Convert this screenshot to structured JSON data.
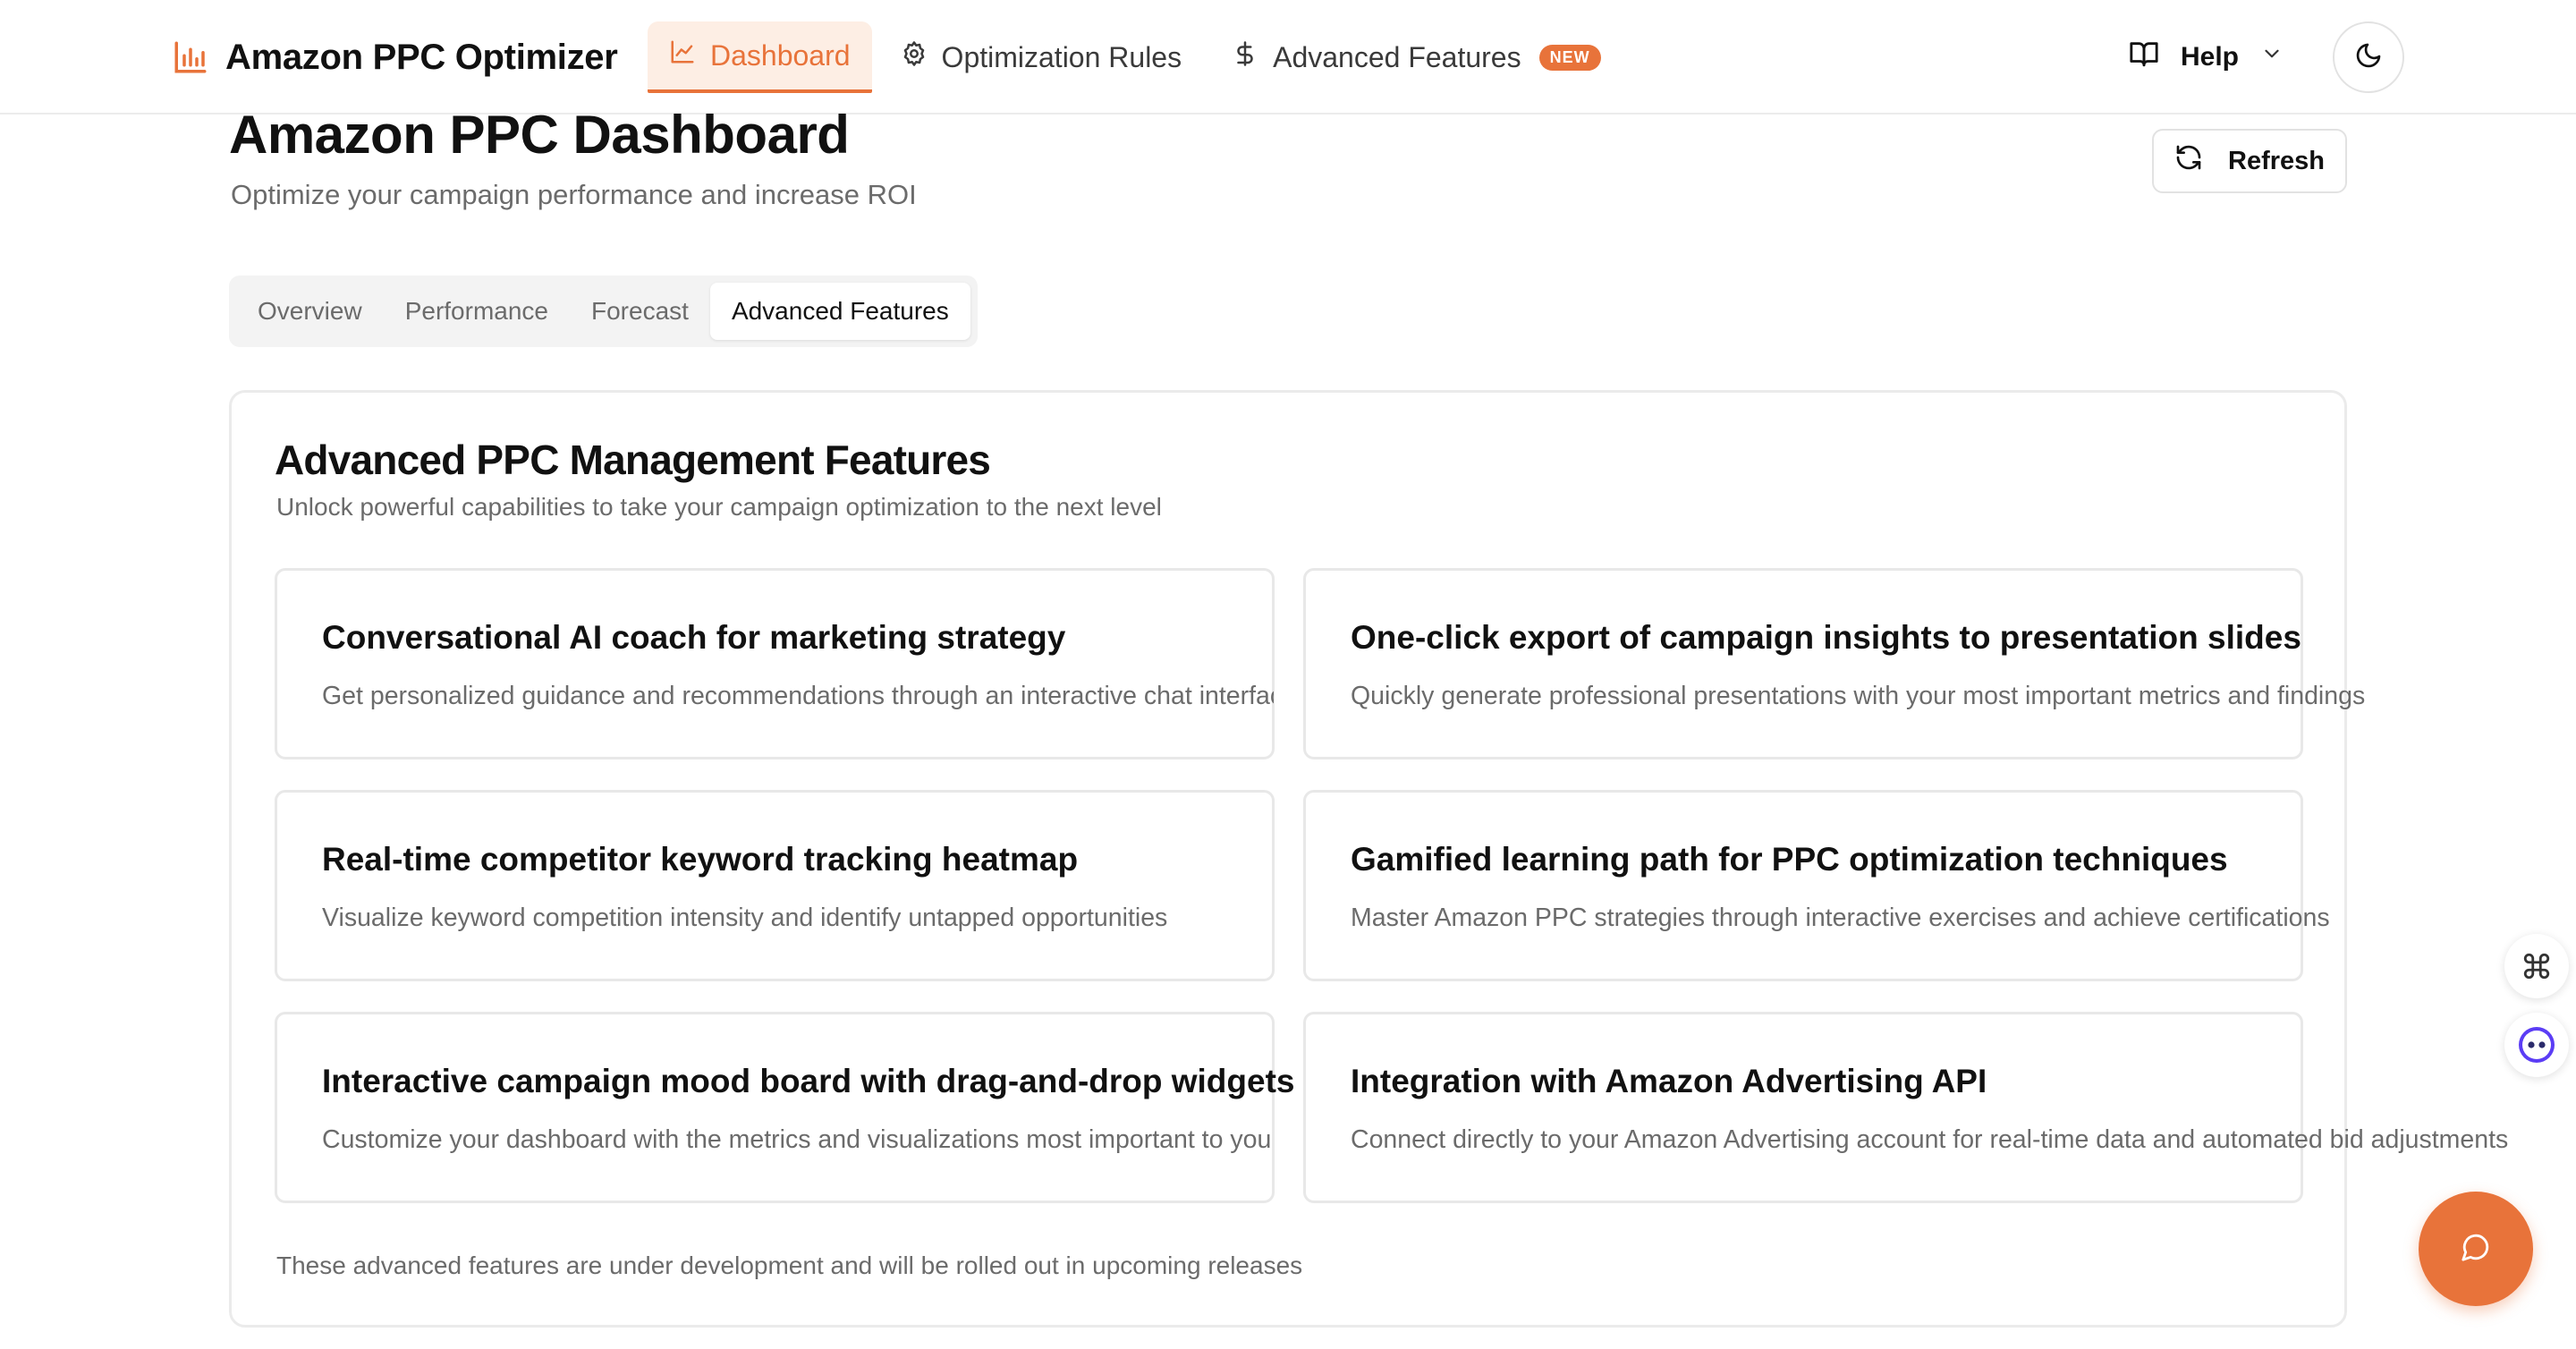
{
  "app": {
    "title": "Amazon PPC Optimizer"
  },
  "nav": {
    "items": [
      {
        "label": "Dashboard",
        "icon": "line-chart-icon"
      },
      {
        "label": "Optimization Rules",
        "icon": "gear-icon"
      },
      {
        "label": "Advanced Features",
        "icon": "dollar-icon",
        "badge": "NEW"
      }
    ],
    "active": "Dashboard"
  },
  "help": {
    "label": "Help"
  },
  "page": {
    "title": "Amazon PPC Dashboard",
    "subtitle": "Optimize your campaign performance and increase ROI",
    "refresh_label": "Refresh"
  },
  "tabs": {
    "items": [
      "Overview",
      "Performance",
      "Forecast",
      "Advanced Features"
    ],
    "active": "Advanced Features"
  },
  "advanced": {
    "title": "Advanced PPC Management Features",
    "subtitle": "Unlock powerful capabilities to take your campaign optimization to the next level",
    "features": [
      {
        "title": "Conversational AI coach for marketing strategy",
        "description": "Get personalized guidance and recommendations through an interactive chat interface"
      },
      {
        "title": "One-click export of campaign insights to presentation slides",
        "description": "Quickly generate professional presentations with your most important metrics and findings"
      },
      {
        "title": "Real-time competitor keyword tracking heatmap",
        "description": "Visualize keyword competition intensity and identify untapped opportunities"
      },
      {
        "title": "Gamified learning path for PPC optimization techniques",
        "description": "Master Amazon PPC strategies through interactive exercises and achieve certifications"
      },
      {
        "title": "Interactive campaign mood board with drag-and-drop widgets",
        "description": "Customize your dashboard with the metrics and visualizations most important to you"
      },
      {
        "title": "Integration with Amazon Advertising API",
        "description": "Connect directly to your Amazon Advertising account for real-time data and automated bid adjustments"
      }
    ],
    "footer": "These advanced features are under development and will be rolled out in upcoming releases"
  },
  "colors": {
    "accent": "#e8733a",
    "accent_bg": "#fdeee4",
    "muted_text": "#6b6b6b",
    "border": "#e8e8e8"
  }
}
